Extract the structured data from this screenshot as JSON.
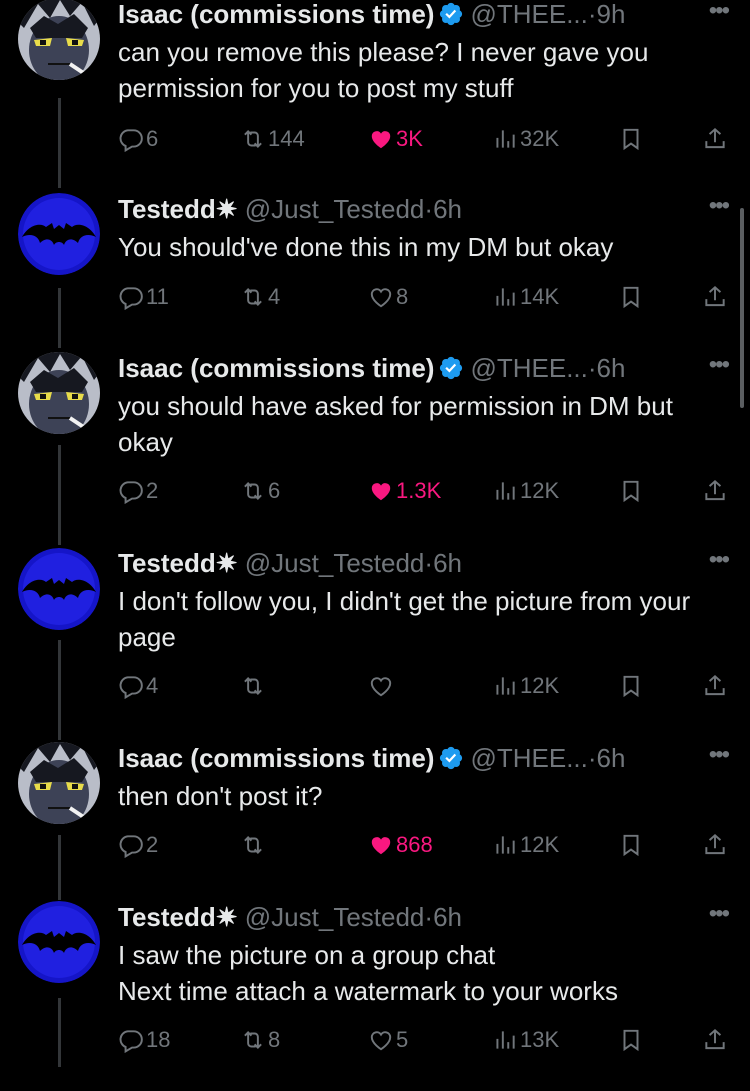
{
  "colors": {
    "accent_like": "#f91880",
    "secondary_text": "#71767b",
    "verified": "#1d9bf0"
  },
  "tweets": [
    {
      "author": "Isaac (commissions time)",
      "verified": true,
      "handle": "@THEE...",
      "sep": "·",
      "time": "9h",
      "text": "can you remove this please? I never gave you permission for you to post my stuff",
      "replies": "6",
      "retweets": "144",
      "likes": "3K",
      "liked": true,
      "views": "32K"
    },
    {
      "author": "Testedd✷",
      "verified": false,
      "handle": "@Just_Testedd",
      "sep": "·",
      "time": "6h",
      "text": "You should've done this in my DM but okay",
      "replies": "11",
      "retweets": "4",
      "likes": "8",
      "liked": false,
      "views": "14K"
    },
    {
      "author": "Isaac (commissions time)",
      "verified": true,
      "handle": "@THEE...",
      "sep": "·",
      "time": "6h",
      "text": "you should have asked for permission in DM but okay",
      "replies": "2",
      "retweets": "6",
      "likes": "1.3K",
      "liked": true,
      "views": "12K"
    },
    {
      "author": "Testedd✷",
      "verified": false,
      "handle": "@Just_Testedd",
      "sep": "·",
      "time": "6h",
      "text": "I don't follow you, I didn't get the picture from your page",
      "replies": "4",
      "retweets": "",
      "likes": "",
      "liked": false,
      "views": "12K"
    },
    {
      "author": "Isaac (commissions time)",
      "verified": true,
      "handle": "@THEE...",
      "sep": "·",
      "time": "6h",
      "text": "then don't post it?",
      "replies": "2",
      "retweets": "",
      "likes": "868",
      "liked": true,
      "views": "12K"
    },
    {
      "author": "Testedd✷",
      "verified": false,
      "handle": "@Just_Testedd",
      "sep": "·",
      "time": "6h",
      "text": "I saw the picture on a group chat\nNext time attach a watermark to your works",
      "replies": "18",
      "retweets": "8",
      "likes": "5",
      "liked": false,
      "views": "13K"
    }
  ]
}
